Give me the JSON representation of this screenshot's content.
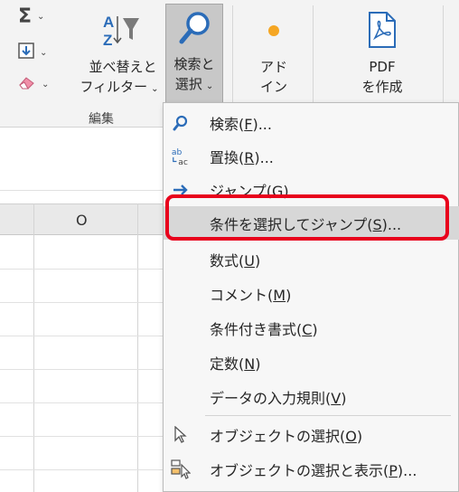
{
  "ribbon": {
    "sort_filter_line1": "並べ替えと",
    "sort_filter_line2": "フィルター",
    "find_select_line1": "検索と",
    "find_select_line2": "選択",
    "addin_line1": "アド",
    "addin_line2": "イン",
    "pdf_line1": "PDF",
    "pdf_line2": "を作成",
    "group_label": "編集",
    "caret": "⌄"
  },
  "sheet": {
    "column_header": "O"
  },
  "menu": {
    "items": [
      {
        "label": "検索(F)...",
        "icon": "search-icon"
      },
      {
        "label": "置換(R)...",
        "icon": "replace-icon"
      },
      {
        "label": "ジャンプ(G)...",
        "icon": "arrow-right-icon"
      },
      {
        "label": "条件を選択してジャンプ(S)...",
        "icon": "none"
      },
      {
        "label": "数式(U)",
        "icon": "none"
      },
      {
        "label": "コメント(M)",
        "icon": "none"
      },
      {
        "label": "条件付き書式(C)",
        "icon": "none"
      },
      {
        "label": "定数(N)",
        "icon": "none"
      },
      {
        "label": "データの入力規則(V)",
        "icon": "none"
      },
      {
        "label": "オブジェクトの選択(O)",
        "icon": "cursor-arrow-icon"
      },
      {
        "label": "オブジェクトの選択と表示(P)...",
        "icon": "selection-pane-icon"
      }
    ],
    "highlighted_index": 3
  },
  "colors": {
    "highlight_box": "#e8001c",
    "accent_blue": "#2b6cb8",
    "addin_orange": "#f5a623"
  }
}
